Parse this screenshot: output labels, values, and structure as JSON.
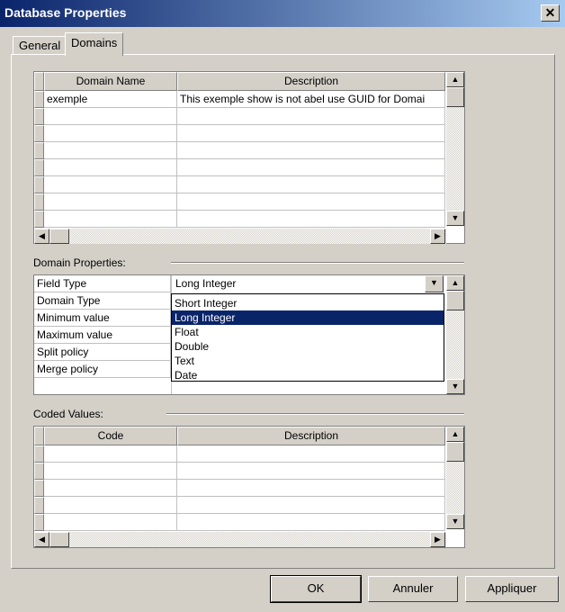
{
  "window": {
    "title": "Database Properties",
    "close_glyph": "✕"
  },
  "tabs": [
    {
      "label": "General"
    },
    {
      "label": "Domains"
    }
  ],
  "domains_table": {
    "columns": [
      "Domain Name",
      "Description"
    ],
    "rows": [
      {
        "name": "exemple",
        "description": "This exemple show is not abel use GUID for Domai"
      }
    ]
  },
  "domain_properties": {
    "label": "Domain Properties:",
    "fields": [
      "Field Type",
      "Domain Type",
      "Minimum value",
      "Maximum value",
      "Split policy",
      "Merge policy"
    ],
    "field_type_value": "Long Integer",
    "dropdown_options": [
      "Short Integer",
      "Long Integer",
      "Float",
      "Double",
      "Text",
      "Date"
    ],
    "selected_option": "Long Integer"
  },
  "coded_values": {
    "label": "Coded Values:",
    "columns": [
      "Code",
      "Description"
    ]
  },
  "buttons": {
    "ok": "OK",
    "cancel": "Annuler",
    "apply": "Appliquer"
  },
  "colors": {
    "title_bar": "#0a246a",
    "selection": "#0a246a",
    "face": "#d4d0c8"
  }
}
